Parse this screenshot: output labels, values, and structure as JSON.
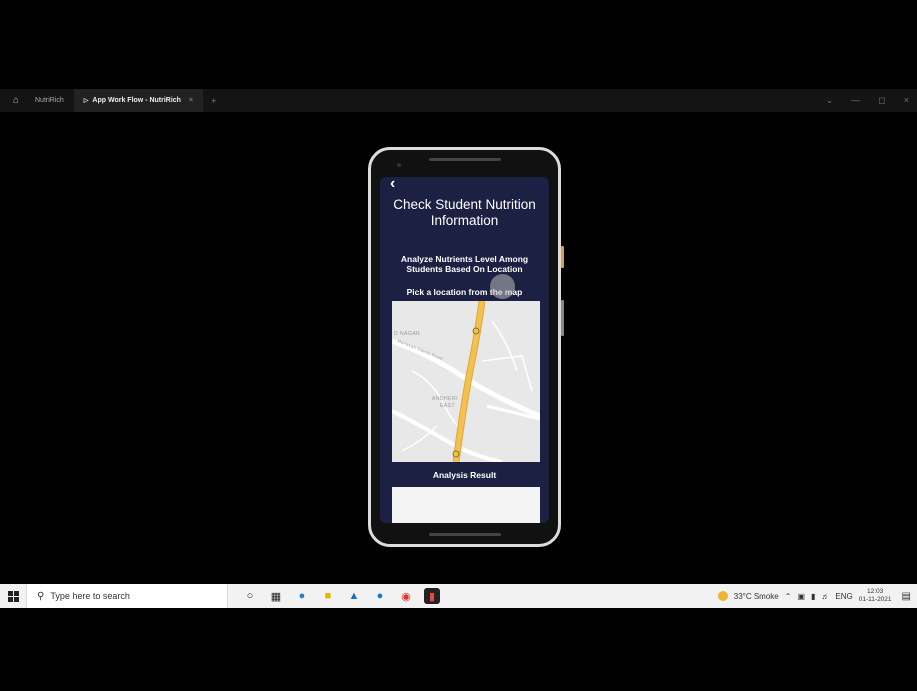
{
  "appbar": {
    "tabs": [
      {
        "label": "NutriRich"
      },
      {
        "label": "App Work Flow - NutriRich"
      }
    ]
  },
  "app": {
    "title": "Check Student Nutrition Information",
    "subtitle": "Analyze Nutrients Level Among Students Based On Location",
    "pick_label": "Pick a location from the map",
    "map_labels": {
      "nagar": "D NAGAR",
      "road1": "Mahakali Caves Road",
      "andheri": "ANDHERI",
      "east": "EAST"
    },
    "analysis_label": "Analysis Result"
  },
  "taskbar": {
    "search_placeholder": "Type here to search",
    "weather": "33°C  Smoke",
    "lang": "ENG",
    "time": "12:03",
    "date": "01-11-2021"
  },
  "colors": {
    "screen_bg": "#1c2043",
    "road": "#f2c14e",
    "map_bg": "#e8e8e8"
  }
}
